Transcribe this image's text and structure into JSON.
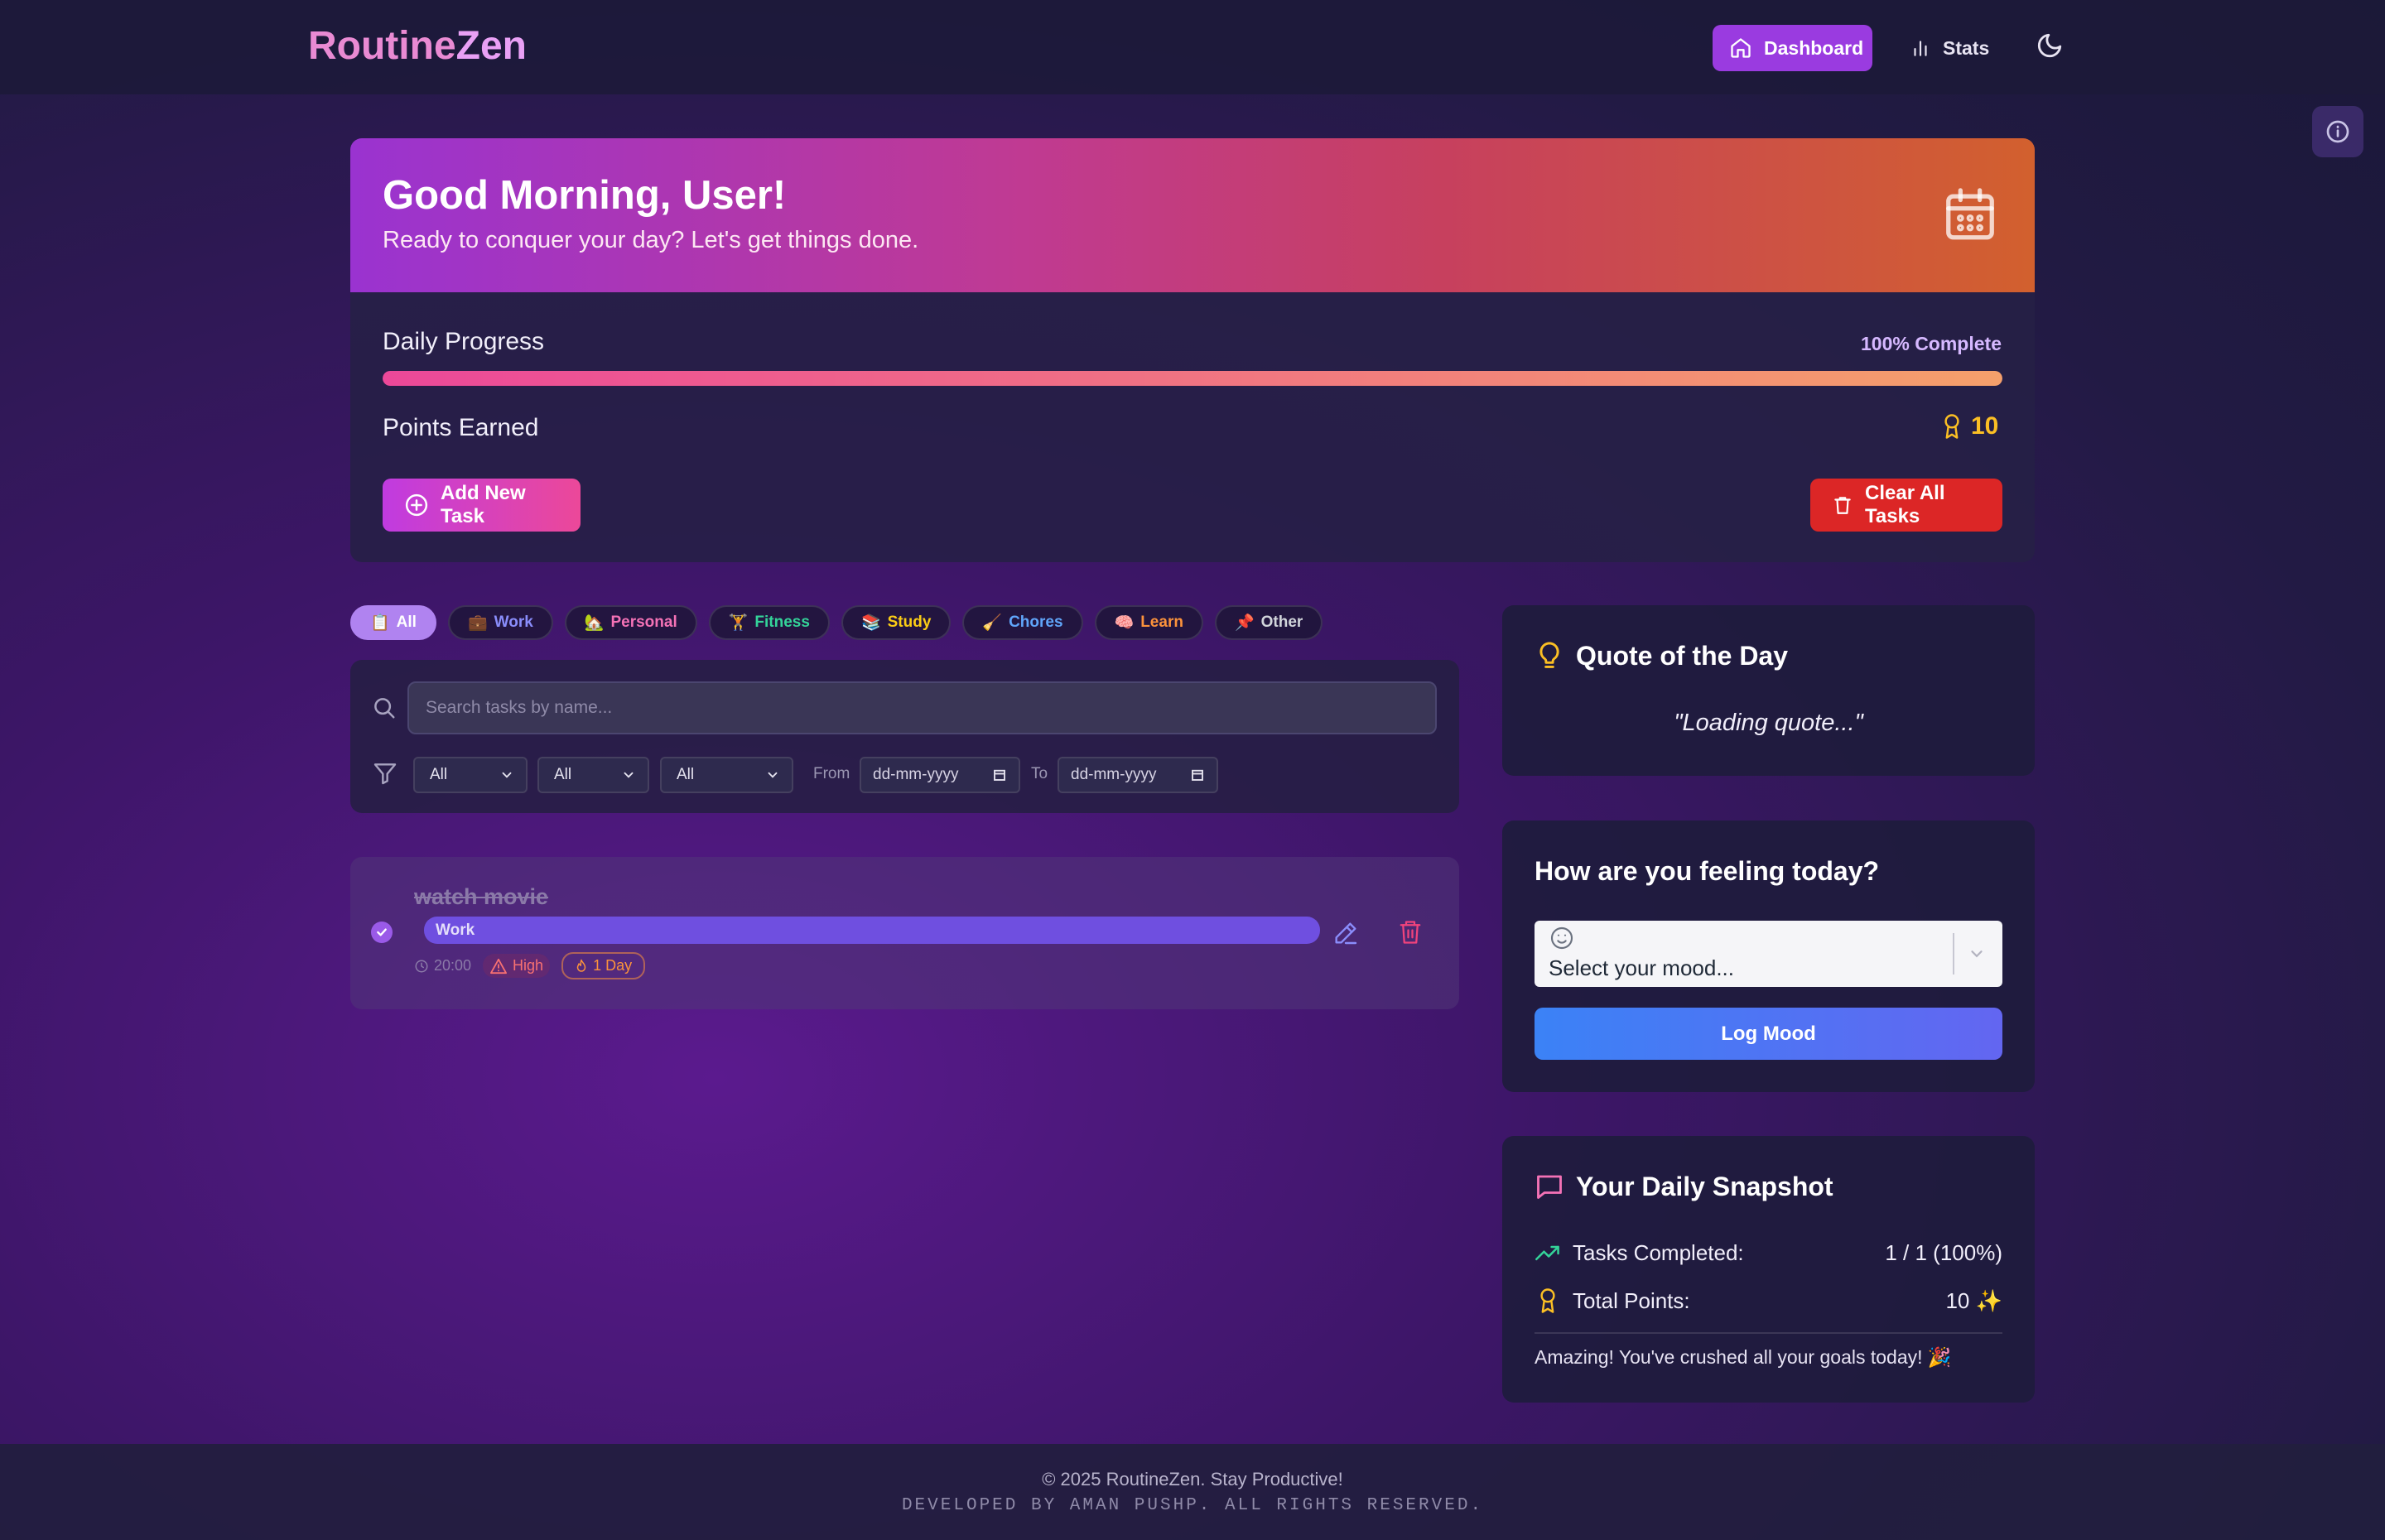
{
  "app": {
    "logo_part1": "Routine",
    "logo_part2": "Zen"
  },
  "nav": {
    "dashboard_label": "Dashboard",
    "stats_label": "Stats"
  },
  "hero": {
    "greeting": "Good Morning, User!",
    "subtitle": "Ready to conquer your day? Let's get things done."
  },
  "progress": {
    "label": "Daily Progress",
    "percent_text": "100% Complete",
    "percent_value": 100,
    "points_label": "Points Earned",
    "points_value": "10",
    "add_task_label": "Add New Task",
    "clear_tasks_label": "Clear All Tasks"
  },
  "categories": [
    {
      "emoji": "📋",
      "label": "All",
      "active": true
    },
    {
      "emoji": "💼",
      "label": "Work"
    },
    {
      "emoji": "🏡",
      "label": "Personal"
    },
    {
      "emoji": "🏋",
      "label": "Fitness"
    },
    {
      "emoji": "📚",
      "label": "Study"
    },
    {
      "emoji": "🧹",
      "label": "Chores"
    },
    {
      "emoji": "🧠",
      "label": "Learn"
    },
    {
      "emoji": "📌",
      "label": "Other"
    }
  ],
  "filters": {
    "search_placeholder": "Search tasks by name...",
    "select1": "All",
    "select2": "All",
    "select3": "All",
    "from_label": "From",
    "to_label": "To",
    "from_date": "dd-mm-yyyy",
    "to_date": "dd-mm-yyyy"
  },
  "task": {
    "title": "watch movie",
    "category": "Work",
    "time": "20:00",
    "priority": "High",
    "streak": "1 Day",
    "completed": true
  },
  "quote": {
    "title": "Quote of the Day",
    "text": "\"Loading quote...\""
  },
  "mood": {
    "title": "How are you feeling today?",
    "placeholder": "Select your mood...",
    "log_label": "Log Mood"
  },
  "snapshot": {
    "title": "Your Daily Snapshot",
    "tasks_label": "Tasks Completed:",
    "tasks_value": "1 / 1 (100%)",
    "points_label": "Total Points:",
    "points_value": "10 ✨",
    "message": "Amazing! You've crushed all your goals today! 🎉"
  },
  "footer": {
    "line1": "© 2025 RoutineZen. Stay Productive!",
    "line2": "DEVELOPED BY AMAN PUSHP. ALL RIGHTS RESERVED."
  },
  "colors": {
    "accent": "#9a3be0",
    "danger": "#dc2626",
    "points": "#fbbf24"
  }
}
